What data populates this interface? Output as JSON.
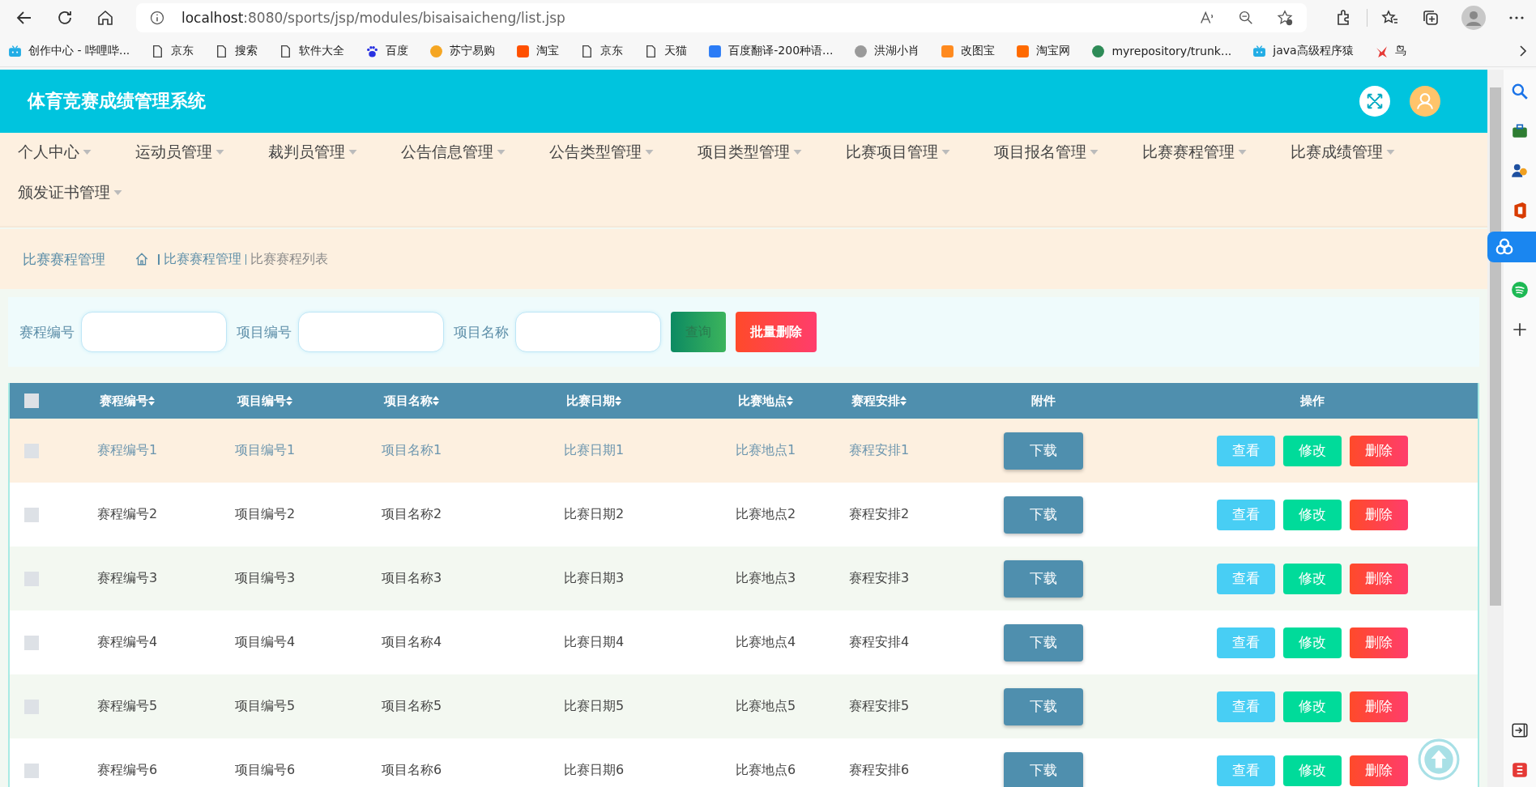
{
  "browser": {
    "url_host": "localhost",
    "url_path": ":8080/sports/jsp/modules/bisaisaicheng/list.jsp"
  },
  "bookmarks": [
    {
      "label": "创作中心 - 哔哩哔...",
      "kind": "tv",
      "color": "#23ade5"
    },
    {
      "label": "京东",
      "kind": "page",
      "color": "#444444"
    },
    {
      "label": "搜索",
      "kind": "page",
      "color": "#444444"
    },
    {
      "label": "软件大全",
      "kind": "page",
      "color": "#444444"
    },
    {
      "label": "百度",
      "kind": "paw",
      "color": "#2932e1"
    },
    {
      "label": "苏宁易购",
      "kind": "circle",
      "color": "#f5a623"
    },
    {
      "label": "淘宝",
      "kind": "square",
      "color": "#ff5000"
    },
    {
      "label": "京东",
      "kind": "page",
      "color": "#444444"
    },
    {
      "label": "天猫",
      "kind": "page",
      "color": "#444444"
    },
    {
      "label": "百度翻译-200种语...",
      "kind": "square",
      "color": "#2b7cf6"
    },
    {
      "label": "洪湖小肖",
      "kind": "circle",
      "color": "#9a9a9a"
    },
    {
      "label": "改图宝",
      "kind": "square",
      "color": "#ff8a1e"
    },
    {
      "label": "淘宝网",
      "kind": "square",
      "color": "#ff6a00"
    },
    {
      "label": "myrepository/trunk...",
      "kind": "circle",
      "color": "#2e8b57"
    },
    {
      "label": "java高级程序猿",
      "kind": "tv",
      "color": "#23ade5"
    },
    {
      "label": "鸟",
      "kind": "bird",
      "color": "#e53935"
    }
  ],
  "header": {
    "title": "体育竞赛成绩管理系统"
  },
  "nav": [
    "个人中心",
    "运动员管理",
    "裁判员管理",
    "公告信息管理",
    "公告类型管理",
    "项目类型管理",
    "比赛项目管理",
    "项目报名管理",
    "比赛赛程管理",
    "比赛成绩管理",
    "颁发证书管理"
  ],
  "breadcrumb": {
    "title": "比赛赛程管理",
    "path": [
      "比赛赛程管理",
      "比赛赛程列表"
    ]
  },
  "search": {
    "fields": [
      "赛程编号",
      "项目编号",
      "项目名称"
    ],
    "query_button": "查询",
    "batch_delete_button": "批量删除"
  },
  "table": {
    "columns": [
      {
        "label": "赛程编号",
        "sortable": true
      },
      {
        "label": "项目编号",
        "sortable": true
      },
      {
        "label": "项目名称",
        "sortable": true
      },
      {
        "label": "比赛日期",
        "sortable": true
      },
      {
        "label": "比赛地点",
        "sortable": true
      },
      {
        "label": "赛程安排",
        "sortable": true
      },
      {
        "label": "附件",
        "sortable": false
      },
      {
        "label": "操作",
        "sortable": false
      }
    ],
    "header_checked": false,
    "rows": [
      {
        "checked": false,
        "highlighted": true,
        "cells": [
          "赛程编号1",
          "项目编号1",
          "项目名称1",
          "比赛日期1",
          "比赛地点1",
          "赛程安排1"
        ],
        "download": "下载",
        "actions": [
          {
            "kind": "view",
            "label": "查看"
          },
          {
            "kind": "edit",
            "label": "修改"
          },
          {
            "kind": "delete",
            "label": "删除"
          }
        ]
      },
      {
        "checked": false,
        "highlighted": false,
        "cells": [
          "赛程编号2",
          "项目编号2",
          "项目名称2",
          "比赛日期2",
          "比赛地点2",
          "赛程安排2"
        ],
        "download": "下载",
        "actions": [
          {
            "kind": "view",
            "label": "查看"
          },
          {
            "kind": "edit",
            "label": "修改"
          },
          {
            "kind": "delete",
            "label": "删除"
          }
        ]
      },
      {
        "checked": false,
        "highlighted": false,
        "cells": [
          "赛程编号3",
          "项目编号3",
          "项目名称3",
          "比赛日期3",
          "比赛地点3",
          "赛程安排3"
        ],
        "download": "下载",
        "actions": [
          {
            "kind": "view",
            "label": "查看"
          },
          {
            "kind": "edit",
            "label": "修改"
          },
          {
            "kind": "delete",
            "label": "删除"
          }
        ]
      },
      {
        "checked": false,
        "highlighted": false,
        "cells": [
          "赛程编号4",
          "项目编号4",
          "项目名称4",
          "比赛日期4",
          "比赛地点4",
          "赛程安排4"
        ],
        "download": "下载",
        "actions": [
          {
            "kind": "view",
            "label": "查看"
          },
          {
            "kind": "edit",
            "label": "修改"
          },
          {
            "kind": "delete",
            "label": "删除"
          }
        ]
      },
      {
        "checked": false,
        "highlighted": false,
        "cells": [
          "赛程编号5",
          "项目编号5",
          "项目名称5",
          "比赛日期5",
          "比赛地点5",
          "赛程安排5"
        ],
        "download": "下载",
        "actions": [
          {
            "kind": "view",
            "label": "查看"
          },
          {
            "kind": "edit",
            "label": "修改"
          },
          {
            "kind": "delete",
            "label": "删除"
          }
        ]
      },
      {
        "checked": false,
        "highlighted": false,
        "cells": [
          "赛程编号6",
          "项目编号6",
          "项目名称6",
          "比赛日期6",
          "比赛地点6",
          "赛程安排6"
        ],
        "download": "下载",
        "actions": [
          {
            "kind": "view",
            "label": "查看"
          },
          {
            "kind": "edit",
            "label": "修改"
          },
          {
            "kind": "delete",
            "label": "删除"
          }
        ]
      }
    ]
  }
}
